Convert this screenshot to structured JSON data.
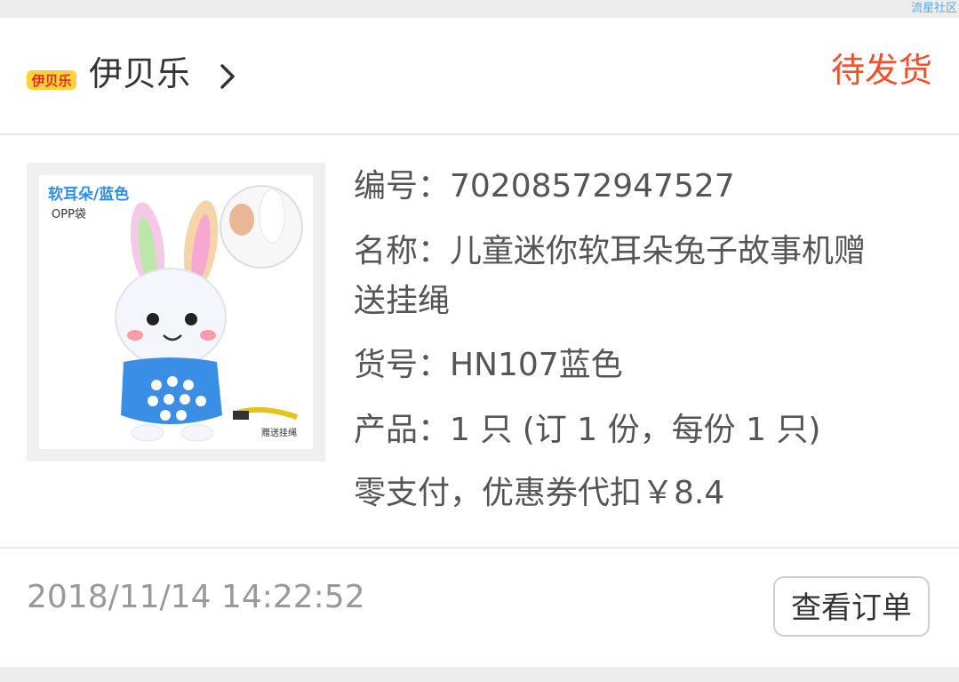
{
  "watermark": "流星社区",
  "shop": {
    "logo_text": "伊贝乐",
    "name": "伊贝乐"
  },
  "order": {
    "status": "待发货",
    "number_line": "编号：70208572947527",
    "name_line1": "名称：儿童迷你软耳朵兔子故事机赠",
    "name_line2": "送挂绳",
    "sku_line": "货号：HN107蓝色",
    "quantity_line": "产品：1 只 (订 1 份，每份 1 只)",
    "payment_line": "零支付，优惠券代扣￥8.4",
    "date": "2018/11/14 14:22:52",
    "view_button": "查看订单"
  },
  "product_image": {
    "tag_title": "软耳朵/蓝色",
    "tag_sub": "OPP袋",
    "gift_label": "赠送挂绳"
  },
  "colors": {
    "status": "#f0502a",
    "accent_blue": "#2f8de4"
  }
}
